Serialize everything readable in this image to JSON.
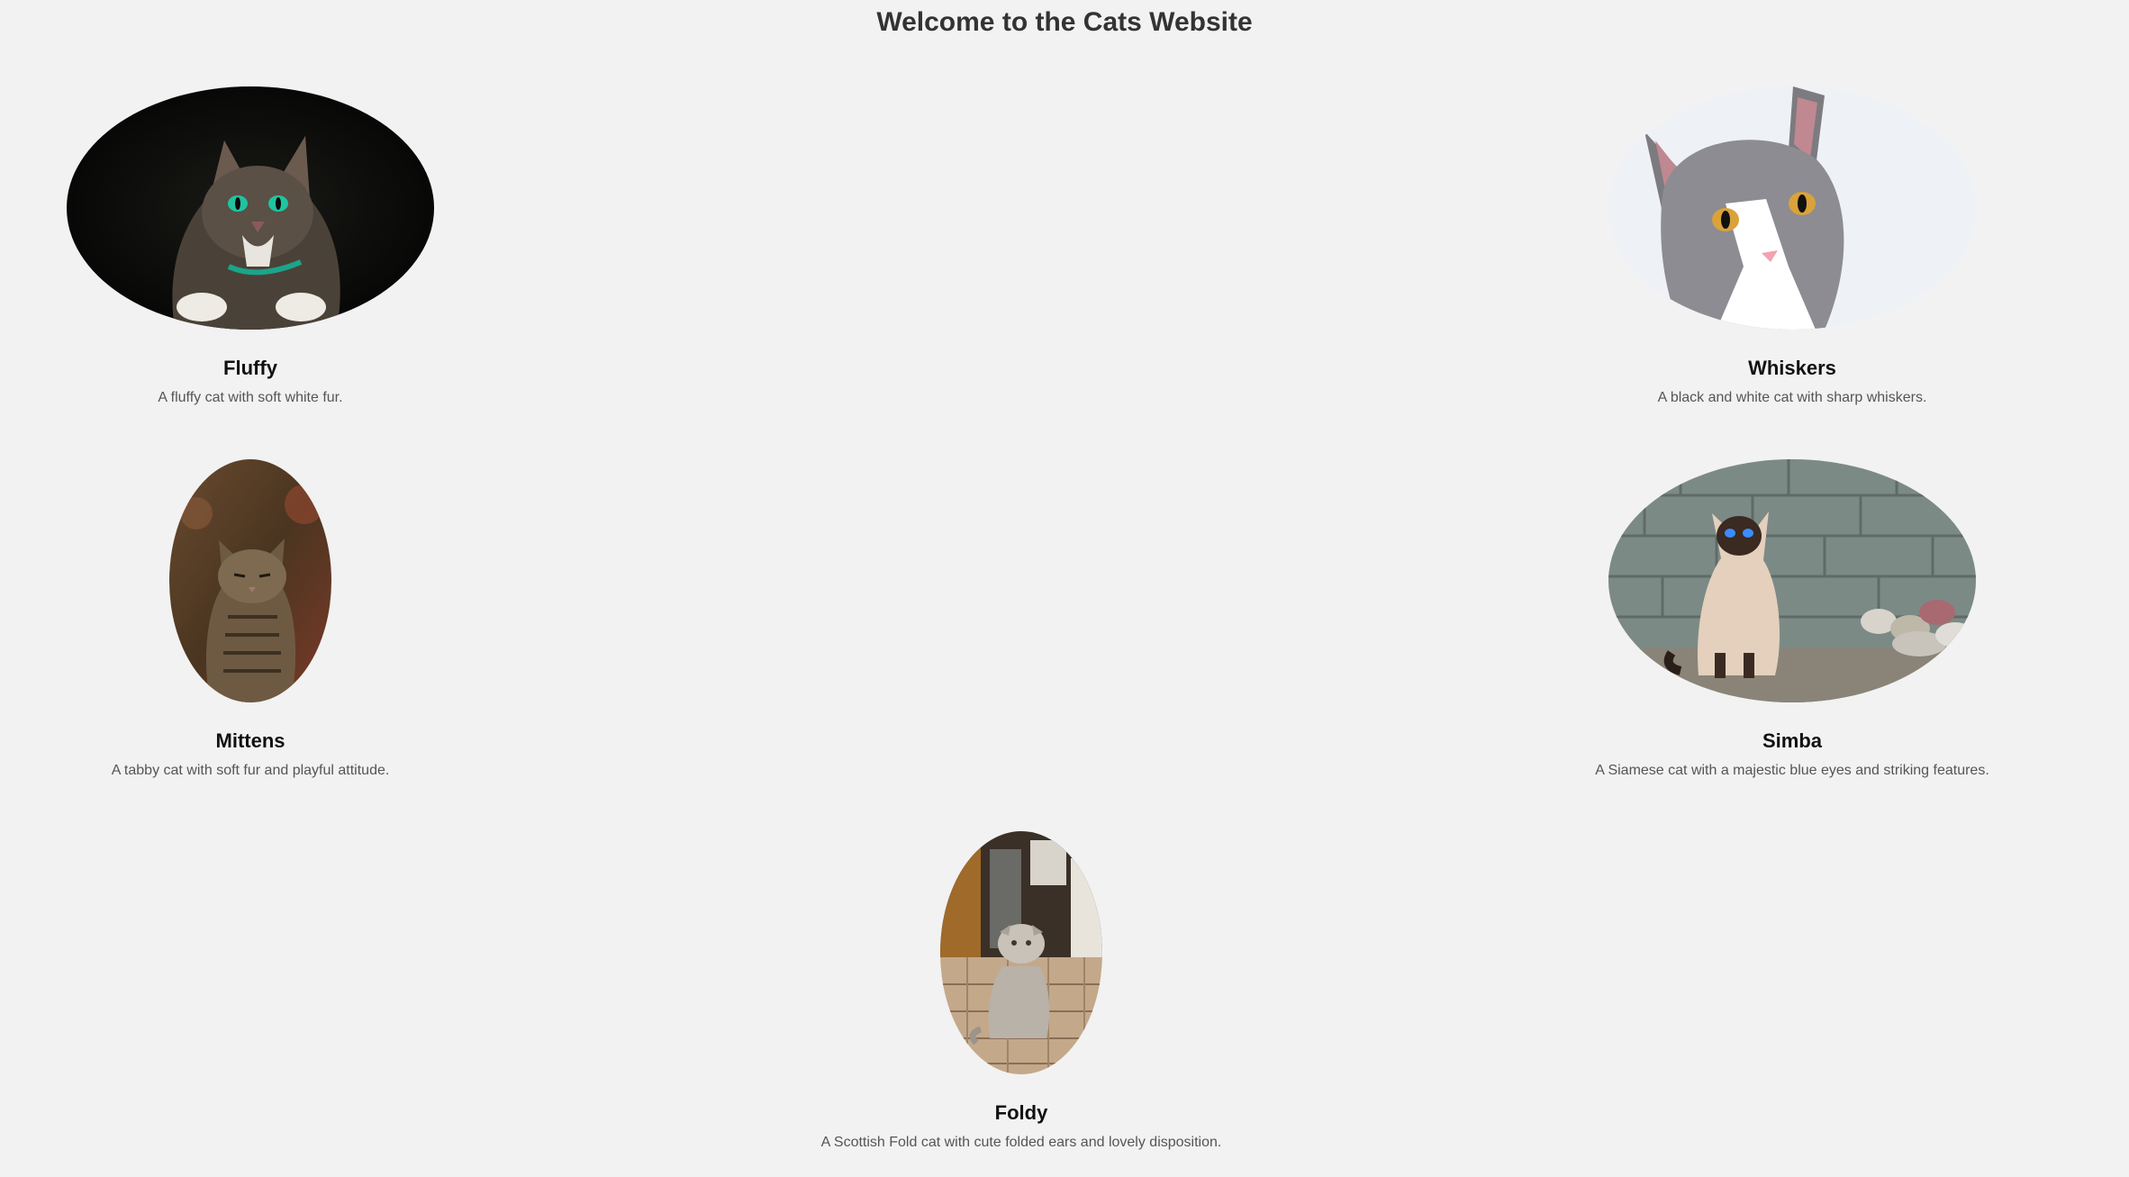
{
  "page": {
    "title": "Welcome to the Cats Website"
  },
  "cats": [
    {
      "name": "Fluffy",
      "description": "A fluffy cat with soft white fur.",
      "photo_icon": "tabby-cat-dark-background-photo"
    },
    {
      "name": "Whiskers",
      "description": "A black and white cat with sharp whiskers.",
      "photo_icon": "gray-white-cat-photo"
    },
    {
      "name": "Mittens",
      "description": "A tabby cat with soft fur and playful attitude.",
      "photo_icon": "tabby-cat-sitting-photo"
    },
    {
      "name": "Simba",
      "description": "A Siamese cat with a majestic blue eyes and striking features.",
      "photo_icon": "siamese-cat-stone-wall-photo"
    },
    {
      "name": "Foldy",
      "description": "A Scottish Fold cat with cute folded ears and lovely disposition.",
      "photo_icon": "scottish-fold-cat-floor-photo"
    }
  ],
  "colors": {
    "background": "#f2f2f2",
    "title": "#333333",
    "name": "#111111",
    "description": "#555555"
  }
}
